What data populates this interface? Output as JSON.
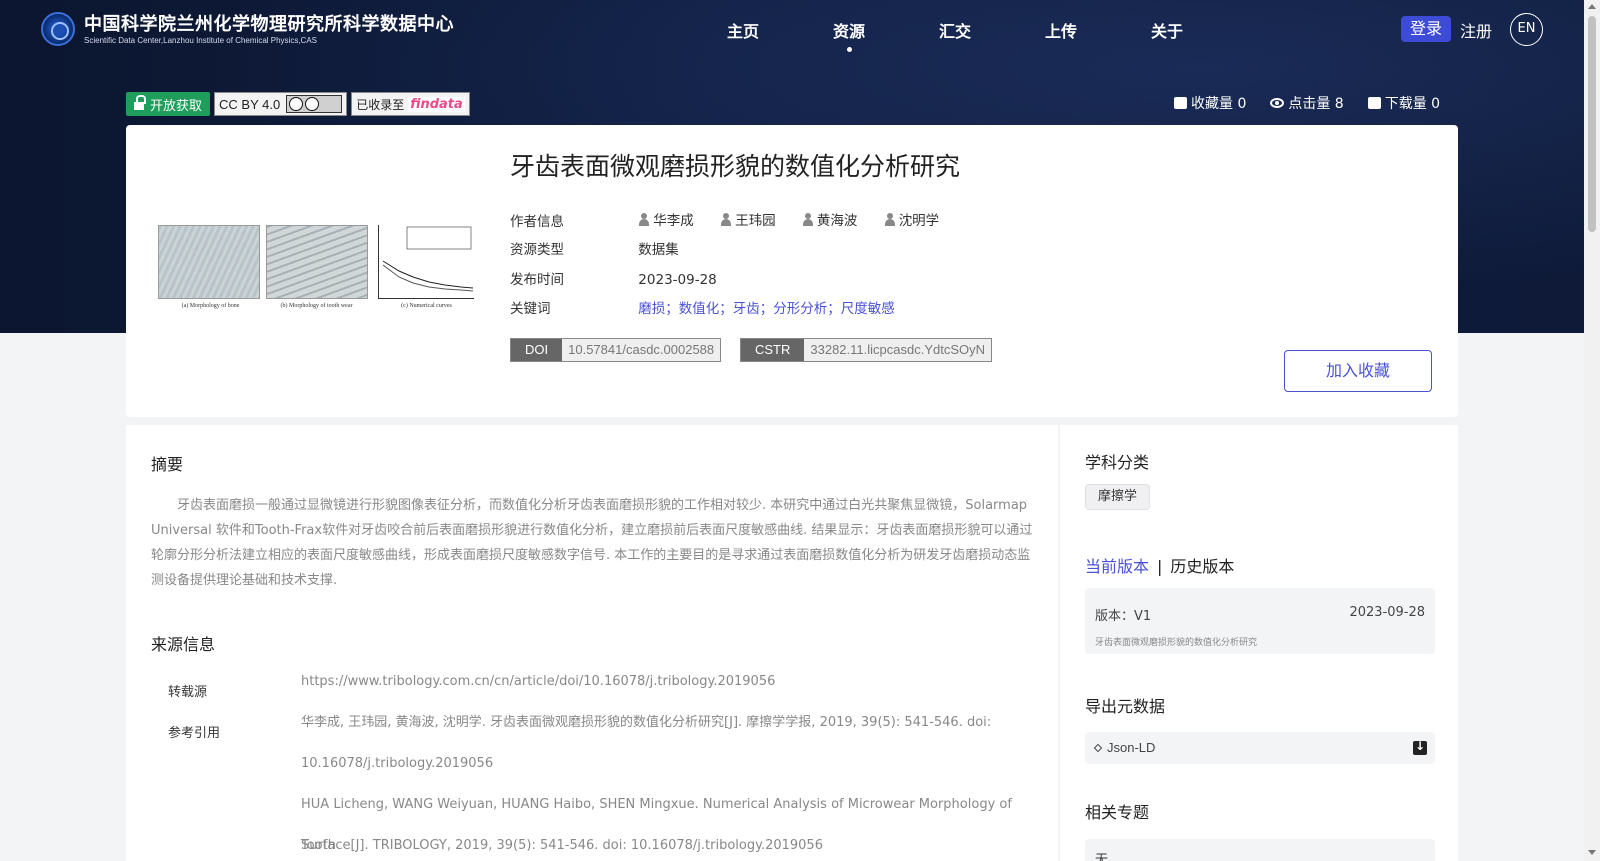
{
  "header": {
    "site_title": "中国科学院兰州化学物理研究所科学数据中心",
    "site_subtitle": "Scientific Data Center,Lanzhou Institute of Chemical Physics,CAS",
    "nav": [
      {
        "label": "主页",
        "active": false
      },
      {
        "label": "资源",
        "active": true
      },
      {
        "label": "汇交",
        "active": false
      },
      {
        "label": "上传",
        "active": false
      },
      {
        "label": "关于",
        "active": false
      }
    ],
    "login_label": "登录",
    "register_label": "注册",
    "lang_label": "EN"
  },
  "badges": {
    "open_access": "开放获取",
    "license": "CC BY 4.0",
    "indexed_prefix": "已收录至",
    "indexed_logo": "findata"
  },
  "stats": {
    "favorites": "收藏量 0",
    "clicks": "点击量 8",
    "downloads": "下载量 0"
  },
  "dataset": {
    "title": "牙齿表面微观磨损形貌的数值化分析研究",
    "figure_captions": [
      "(a) Morphology of bone",
      "(b) Morphology of tooth wear",
      "(c) Numerical curves"
    ],
    "meta": {
      "authors_label": "作者信息",
      "authors": [
        "华李成",
        "王玮园",
        "黄海波",
        "沈明学"
      ],
      "type_label": "资源类型",
      "type": "数据集",
      "date_label": "发布时间",
      "date": "2023-09-28",
      "keywords_label": "关键词",
      "keywords": "磨损；数值化；牙齿；分形分析；尺度敏感"
    },
    "doi_key": "DOI",
    "doi": "10.57841/casdc.0002588",
    "cstr_key": "CSTR",
    "cstr": "33282.11.licpcasdc.YdtcSOyN",
    "favorite_button": "加入收藏"
  },
  "abstract": {
    "title": "摘要",
    "text": "牙齿表面磨损一般通过显微镜进行形貌图像表征分析，而数值化分析牙齿表面磨损形貌的工作相对较少. 本研究中通过白光共聚焦显微镜，Solarmap Universal 软件和Tooth-Frax软件对牙齿咬合前后表面磨损形貌进行数值化分析，建立磨损前后表面尺度敏感曲线. 结果显示：牙齿表面磨损形貌可以通过轮廓分形分析法建立相应的表面尺度敏感曲线，形成表面磨损尺度敏感数字信号. 本工作的主要目的是寻求通过表面磨损数值化分析为研发牙齿磨损动态监测设备提供理论基础和技术支撑."
  },
  "source": {
    "title": "来源信息",
    "repost_label": "转载源",
    "repost_url": "https://www.tribology.com.cn/cn/article/doi/10.16078/j.tribology.2019056",
    "citation_label": "参考引用",
    "citation_cn_1": "华李成, 王玮园, 黄海波, 沈明学. 牙齿表面微观磨损形貌的数值化分析研究[J]. 摩擦学学报, 2019, 39(5): 541-546. doi:",
    "citation_cn_2": "10.16078/j.tribology.2019056",
    "citation_en_1": "HUA Licheng, WANG Weiyuan, HUANG Haibo, SHEN Mingxue. Numerical Analysis of Microwear Morphology of Tooth",
    "citation_en_2": "Surface[J]. TRIBOLOGY, 2019, 39(5): 541-546. doi: 10.16078/j.tribology.2019056"
  },
  "sidebar": {
    "subject_title": "学科分类",
    "subject_tag": "摩擦学",
    "version_current": "当前版本",
    "version_history": "历史版本",
    "version_no": "版本：V1",
    "version_date": "2023-09-28",
    "version_desc": "牙齿表面微观磨损形貌的数值化分析研究",
    "export_title": "导出元数据",
    "export_value": "Json-LD",
    "topic_title": "相关专题",
    "topic_value": "无"
  }
}
